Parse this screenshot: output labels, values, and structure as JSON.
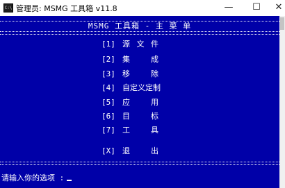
{
  "window": {
    "title": "管理员: MSMG 工具箱 v11.8",
    "icon_text": "C:\\",
    "minimize": "—",
    "maximize": "☐",
    "close": "✕"
  },
  "console": {
    "menu_title": "MSMG 工具箱 - 主 菜 单",
    "items": [
      {
        "key": "[1]",
        "label": "源文件"
      },
      {
        "key": "[2]",
        "label": "集成"
      },
      {
        "key": "[3]",
        "label": "移除"
      },
      {
        "key": "[4]",
        "label": "自定义定制"
      },
      {
        "key": "[5]",
        "label": "应用"
      },
      {
        "key": "[6]",
        "label": "目标"
      },
      {
        "key": "[7]",
        "label": "工具"
      },
      {
        "key": "[X]",
        "label": "退出"
      }
    ],
    "prompt": "请输入你的选项 :"
  },
  "colors": {
    "console_bg": "#0000a8",
    "console_fg": "#ffffff"
  }
}
